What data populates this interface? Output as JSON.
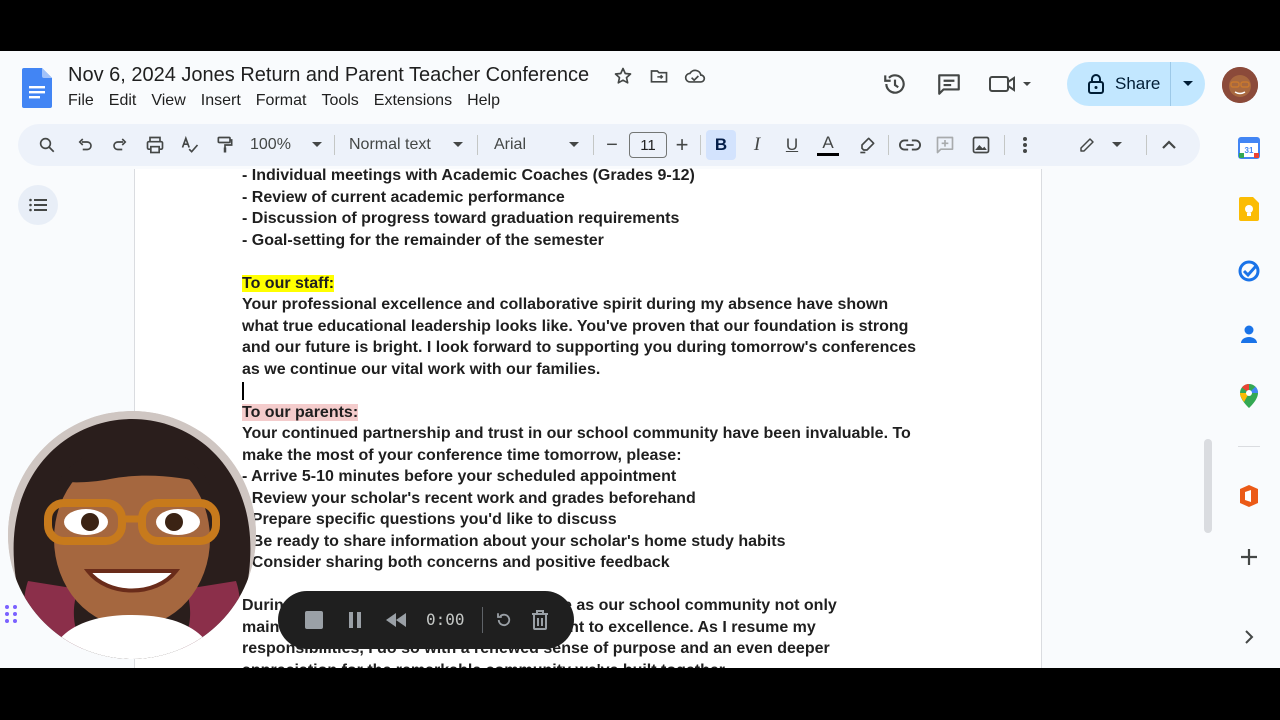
{
  "document": {
    "title": "Nov 6, 2024 Jones Return and Parent Teacher Conference"
  },
  "menu": [
    "File",
    "Edit",
    "View",
    "Insert",
    "Format",
    "Tools",
    "Extensions",
    "Help"
  ],
  "share": {
    "label": "Share"
  },
  "toolbar": {
    "zoom": "100%",
    "style": "Normal text",
    "font": "Arial",
    "font_size": "11",
    "bold_label": "B",
    "italic_label": "I",
    "underline_label": "U",
    "text_color_label": "A",
    "minus_label": "−",
    "plus_label": "+"
  },
  "body": {
    "lines": [
      "- Individual meetings with Academic Coaches (Grades 9-12)",
      "- Review of current academic performance",
      "- Discussion of progress toward graduation requirements",
      "- Goal-setting for the remainder of the semester",
      "",
      "To our staff:",
      "Your professional excellence and collaborative spirit during my absence have shown",
      "what true educational leadership looks like. You've proven that our foundation is strong",
      "and our future is bright. I look forward to supporting you during tomorrow's conferences",
      "as we continue our vital work with our families.",
      "",
      "To our parents:",
      "Your continued partnership and trust in our school community have been invaluable. To",
      "make the most of your conference time tomorrow, please:",
      "- Arrive 5-10 minutes before your scheduled appointment",
      "- Review your scholar's recent work and grades beforehand",
      "- Prepare specific questions you'd like to discuss",
      "- Be ready to share information about your scholar's home study habits",
      "- Consider sharing both concerns and positive feedback",
      "",
      "During my absence, I felt an immense pride as our school community not only",
      "maintained but strengthened its commitment to excellence. As I resume my",
      "responsibilities, I do so with a renewed sense of purpose and an even deeper",
      "appreciation for the remarkable community we've built together."
    ]
  },
  "recorder": {
    "time": "0:00"
  },
  "colors": {
    "highlight_staff": "#ffff00",
    "highlight_parents": "#f4cccc",
    "share_bg": "#c2e7ff",
    "toolbar_bg": "#edf2fa"
  },
  "icons": [
    "search-icon",
    "undo-icon",
    "redo-icon",
    "print-icon",
    "spellcheck-icon",
    "paint-format-icon",
    "star-icon",
    "move-folder-icon",
    "cloud-status-icon",
    "history-icon",
    "comment-icon",
    "meet-icon",
    "lock-icon",
    "link-icon",
    "add-comment-icon",
    "image-icon",
    "more-icon",
    "edit-mode-icon",
    "collapse-icon",
    "outline-icon",
    "calendar-icon",
    "keep-icon",
    "tasks-icon",
    "contacts-icon",
    "maps-icon",
    "office-icon",
    "add-icon",
    "expand-panel-icon",
    "stop-icon",
    "pause-icon",
    "rewind-icon",
    "restart-icon",
    "delete-icon"
  ]
}
